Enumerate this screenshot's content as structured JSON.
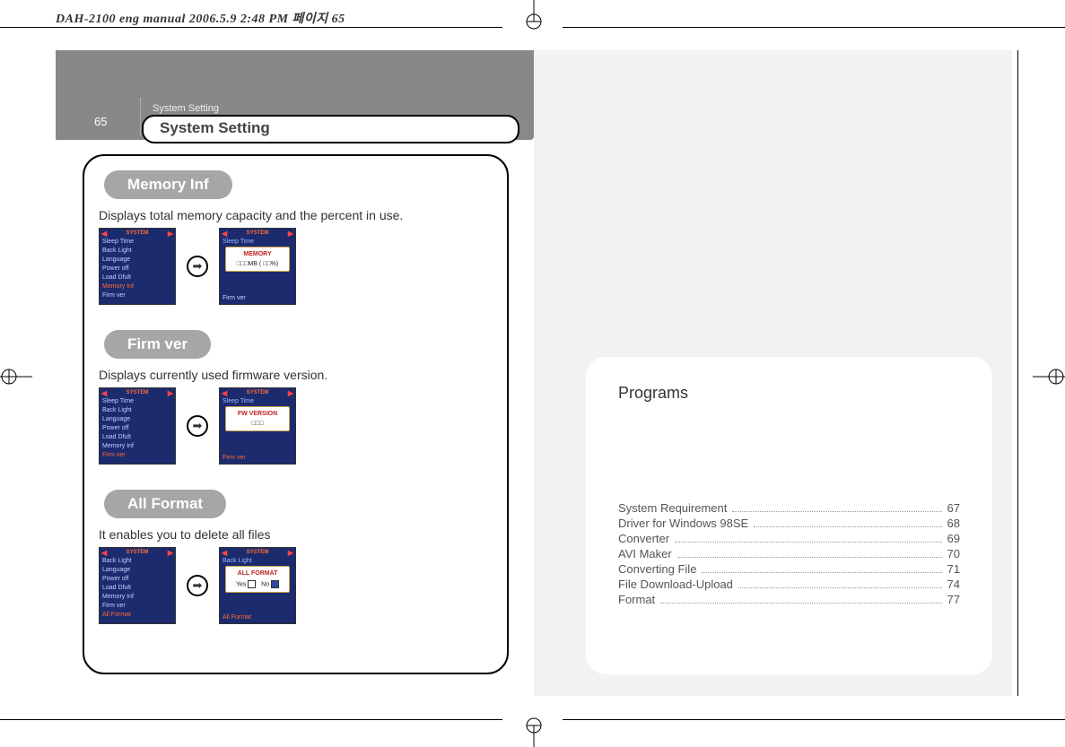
{
  "top_strip": "DAH-2100 eng manual   2006.5.9 2:48 PM 페이지 65",
  "left_page": {
    "page_number": "65",
    "breadcrumb": "System Setting",
    "title": "System Setting",
    "sections": [
      {
        "pill": "Memory Inf",
        "desc": "Displays total memory capacity and the percent in use.",
        "screen1": {
          "title": "SYSTEM",
          "items": [
            "Sleep Time",
            "Back Light",
            "Language",
            "Power off",
            "Load Dfult",
            "Memory Inf",
            "Firm ver"
          ],
          "hot_index": 5
        },
        "screen2": {
          "title": "SYSTEM",
          "top_line": "Sleep Time",
          "bottom_line": "Firm ver",
          "popup_title": "MEMORY",
          "popup_body": "□□□MB ( □□%)"
        }
      },
      {
        "pill": "Firm ver",
        "desc": "Displays currently used firmware version.",
        "screen1": {
          "title": "SYSTEM",
          "items": [
            "Sleep Time",
            "Back Light",
            "Language",
            "Power off",
            "Load Dfult",
            "Memory Inf",
            "Firm ver"
          ],
          "hot_index": 6
        },
        "screen2": {
          "title": "SYSTEM",
          "top_line": "Sleep Time",
          "bottom_line": "Firm ver",
          "popup_title": "FW VERSION",
          "popup_body": "□□□"
        }
      },
      {
        "pill": "All Format",
        "desc": "It enables you to delete all files",
        "screen1": {
          "title": "SYSTEM",
          "items": [
            "Back Light",
            "Language",
            "Power off",
            "Load Dfult",
            "Memory Inf",
            "Firm ver",
            "All Format"
          ],
          "hot_index": 6
        },
        "screen2": {
          "title": "SYSTEM",
          "top_line": "Back Light",
          "bottom_line": "All Format",
          "popup_title": "ALL FORMAT",
          "popup_yes": "Yes",
          "popup_no": "No"
        }
      }
    ]
  },
  "right_page": {
    "title": "Programs",
    "toc": [
      {
        "label": "System Requirement",
        "page": "67"
      },
      {
        "label": "Driver for Windows 98SE",
        "page": "68"
      },
      {
        "label": "Converter",
        "page": "69"
      },
      {
        "label": "AVI Maker",
        "page": "70"
      },
      {
        "label": "Converting File",
        "page": "71"
      },
      {
        "label": "File Download-Upload",
        "page": "74"
      },
      {
        "label": "Format",
        "page": "77"
      }
    ]
  }
}
